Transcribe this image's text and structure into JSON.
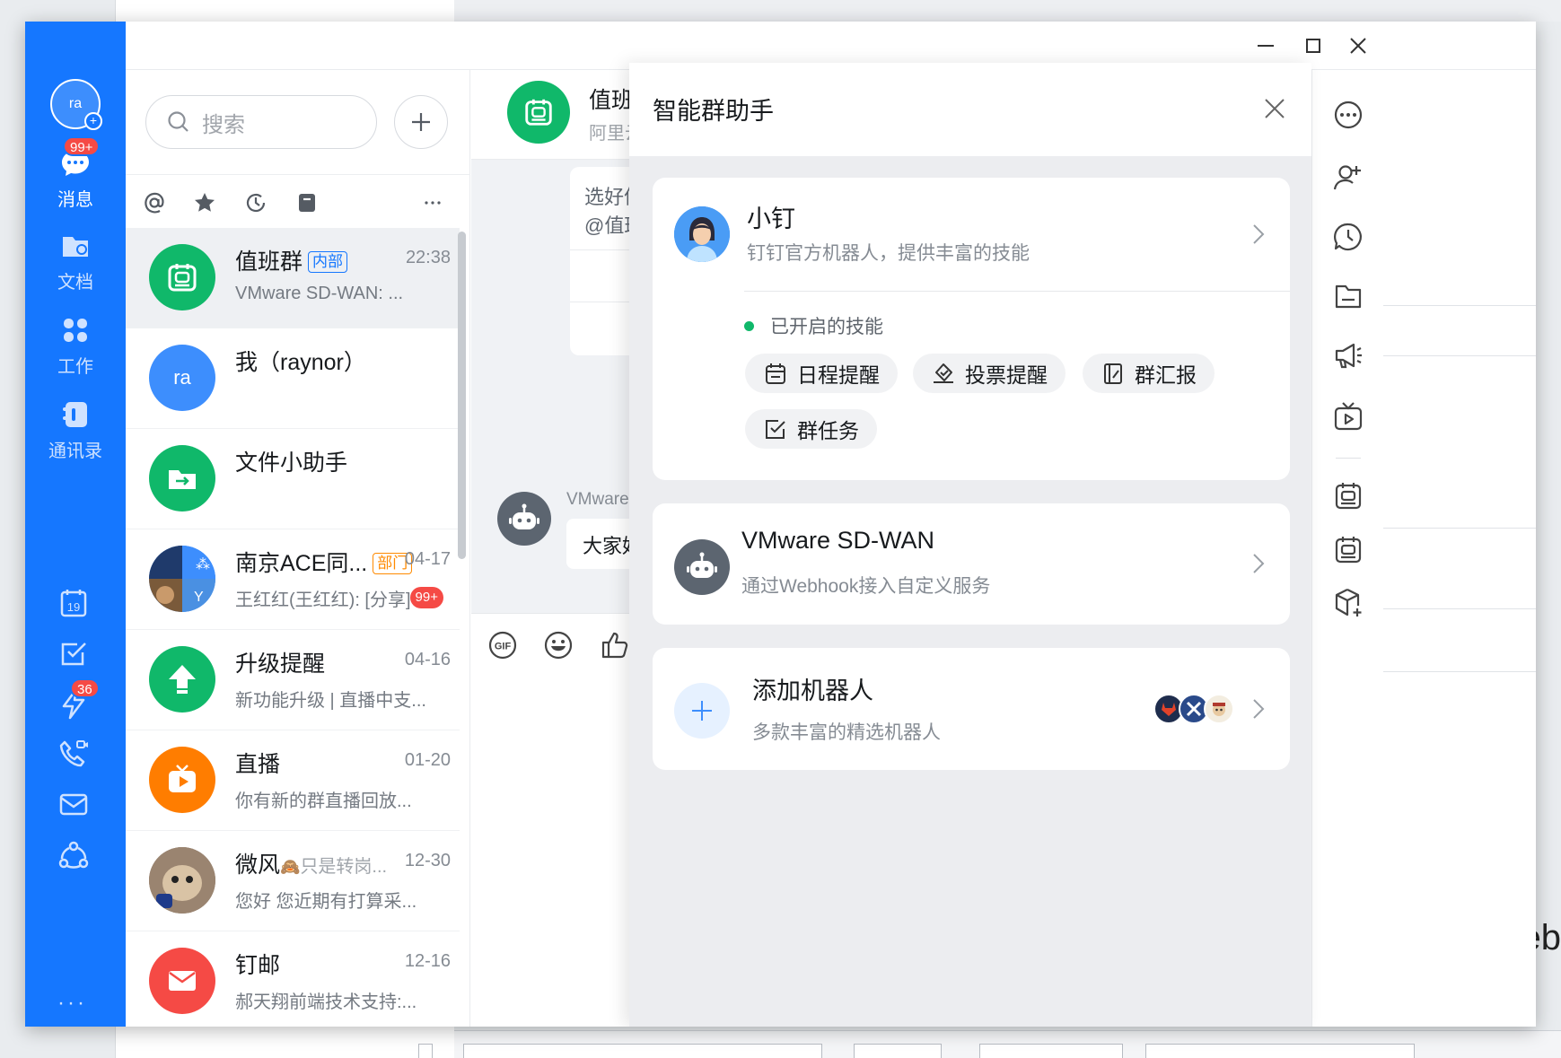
{
  "rail": {
    "avatar_text": "ra",
    "items": [
      {
        "label": "消息",
        "badge": "99+",
        "icon": "chat-bubble-icon"
      },
      {
        "label": "文档",
        "icon": "folder-icon"
      },
      {
        "label": "工作",
        "icon": "apps-grid-icon"
      },
      {
        "label": "通讯录",
        "icon": "contacts-icon"
      }
    ],
    "lower_icons": [
      {
        "icon": "calendar-icon",
        "text": "19"
      },
      {
        "icon": "todo-check-icon"
      },
      {
        "icon": "ding-lightning-icon",
        "badge": "36"
      },
      {
        "icon": "phone-video-icon"
      },
      {
        "icon": "mail-icon"
      },
      {
        "icon": "org-network-icon"
      }
    ],
    "more": "···"
  },
  "search": {
    "placeholder": "搜索"
  },
  "conversations": [
    {
      "name": "值班群",
      "tag": "内部",
      "time": "22:38",
      "preview": "VMware SD-WAN: ...",
      "selected": true
    },
    {
      "name": "我（raynor）",
      "avatar_text": "ra",
      "time": "",
      "preview": ""
    },
    {
      "name": "文件小助手",
      "time": "",
      "preview": ""
    },
    {
      "name": "南京ACE同...",
      "tag": "部门",
      "time": "04-17",
      "preview": "王红红(王红红): [分享]",
      "badge": "99+"
    },
    {
      "name": "升级提醒",
      "time": "04-16",
      "preview": "新功能升级 | 直播中支..."
    },
    {
      "name": "直播",
      "time": "01-20",
      "preview": "你有新的群直播回放..."
    },
    {
      "name": "微风",
      "status": "只是转岗...",
      "time": "12-30",
      "preview": "您好 您近期有打算采..."
    },
    {
      "name": "钉邮",
      "time": "12-16",
      "preview": "郝天翔前端技术支持:..."
    }
  ],
  "chat": {
    "title": "值班群",
    "subtitle": "阿里云AC",
    "card_line1": "选好值班",
    "card_line2": "@值班人",
    "bot_sender": "VMware SD",
    "bot_message": "大家好!"
  },
  "drawer": {
    "title": "智能群助手",
    "xiaoding": {
      "name": "小钉",
      "desc": "钉钉官方机器人，提供丰富的技能"
    },
    "skills_status": "已开启的技能",
    "skills": [
      "日程提醒",
      "投票提醒",
      "群汇报",
      "群任务"
    ],
    "vmware": {
      "name": "VMware SD-WAN",
      "desc": "通过Webhook接入自定义服务"
    },
    "add_robot": {
      "name": "添加机器人",
      "desc": "多款丰富的精选机器人"
    }
  },
  "background": {
    "right_text": "eb"
  }
}
